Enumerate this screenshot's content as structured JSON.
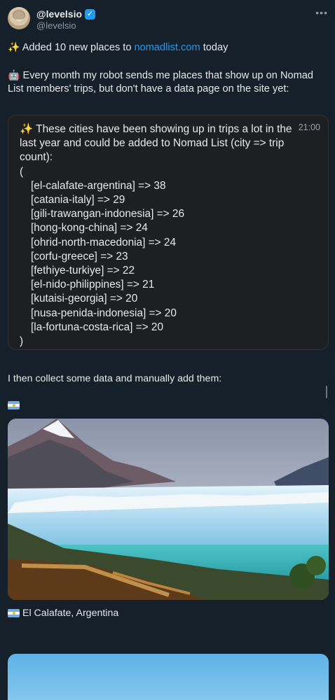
{
  "author": {
    "display_name": "@levelsio",
    "handle": "@levelsio"
  },
  "tweet": {
    "line1_emoji": "✨",
    "line1_prefix": "Added 10 new places to",
    "line1_link": "nomadlist.com",
    "line1_suffix": "today",
    "line2_emoji": "🤖",
    "line2_text": "Every month my robot sends me places that show up on Nomad List members' trips, but don't have a data page on the site yet:"
  },
  "quote": {
    "time": "21:00",
    "intro_emoji": "✨",
    "intro_text": "These cities have been showing up in trips a lot in the last year and could be added to Nomad List (city => trip count):",
    "open_paren": "(",
    "close_paren": ")",
    "items": [
      "[el-calafate-argentina] => 38",
      "[catania-italy] => 29",
      "[gili-trawangan-indonesia] => 26",
      "[hong-kong-china] => 24",
      "[ohrid-north-macedonia] => 24",
      "[corfu-greece] => 23",
      "[fethiye-turkiye] => 22",
      "[el-nido-philippines] => 21",
      "[kutaisi-georgia] => 20",
      "[nusa-penida-indonesia] => 20",
      "[la-fortuna-costa-rica] => 20"
    ]
  },
  "after_text": "I then collect some data and manually add them:",
  "caption": "El Calafate, Argentina",
  "colors": {
    "background": "#15202b",
    "link": "#1d9bf0",
    "quote_bg": "#1e1f22"
  },
  "icons": [
    "verified-badge-icon",
    "more-options-icon",
    "argentina-flag-icon"
  ]
}
